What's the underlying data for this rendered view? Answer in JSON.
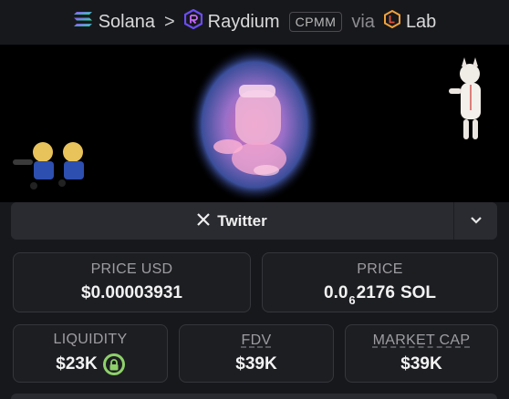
{
  "breadcrumb": {
    "chain": "Solana",
    "dex": "Raydium",
    "pool_type": "CPMM",
    "via": "via",
    "source": "Lab"
  },
  "colors": {
    "accent_green": "#8ed16a",
    "raydium_purple": "#6b4cf6",
    "lab_orange": "#f0a13a"
  },
  "social": {
    "twitter_label": "Twitter",
    "icons": [
      "x-icon",
      "chevron-down-icon"
    ]
  },
  "stats": {
    "price_usd": {
      "label": "PRICE USD",
      "value": "$0.00003931"
    },
    "price": {
      "label": "PRICE",
      "prefix": "0.0",
      "zeros": "6",
      "digits": "2176",
      "unit": "SOL"
    },
    "liquidity": {
      "label": "LIQUIDITY",
      "value": "$23K"
    },
    "fdv": {
      "label": "FDV",
      "value": "$39K"
    },
    "market_cap": {
      "label": "MARKET CAP",
      "value": "$39K"
    }
  }
}
